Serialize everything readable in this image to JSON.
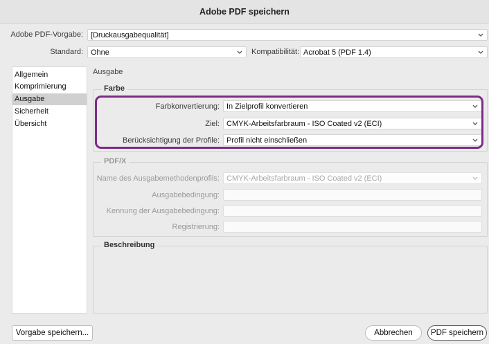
{
  "window": {
    "title": "Adobe PDF speichern"
  },
  "preset": {
    "label": "Adobe PDF-Vorgabe:",
    "value": "[Druckausgabequalität]"
  },
  "standard": {
    "label": "Standard:",
    "value": "Ohne"
  },
  "compat": {
    "label": "Kompatibilität:",
    "value": "Acrobat 5 (PDF 1.4)"
  },
  "sidebar": {
    "items": [
      {
        "label": "Allgemein"
      },
      {
        "label": "Komprimierung"
      },
      {
        "label": "Ausgabe"
      },
      {
        "label": "Sicherheit"
      },
      {
        "label": "Übersicht"
      }
    ]
  },
  "section": {
    "title": "Ausgabe"
  },
  "farbe": {
    "title": "Farbe",
    "conversion": {
      "label": "Farbkonvertierung:",
      "value": "In Zielprofil konvertieren"
    },
    "target": {
      "label": "Ziel:",
      "value": "CMYK-Arbeitsfarbraum - ISO Coated v2 (ECI)"
    },
    "profiles": {
      "label": "Berücksichtigung der Profile:",
      "value": "Profil nicht einschließen"
    }
  },
  "pdfx": {
    "title": "PDF/X",
    "output_profile": {
      "label": "Name des Ausgabemethodenprofils:",
      "value": "CMYK-Arbeitsfarbraum - ISO Coated v2 (ECI)"
    },
    "condition": {
      "label": "Ausgabebedingung:"
    },
    "condition_id": {
      "label": "Kennung der Ausgabebedingung:"
    },
    "registry": {
      "label": "Registrierung:"
    }
  },
  "description": {
    "title": "Beschreibung"
  },
  "buttons": {
    "save_preset": "Vorgabe speichern...",
    "cancel": "Abbrechen",
    "save_pdf": "PDF speichern"
  },
  "colors": {
    "highlight": "#7b2c86",
    "active_nav": "#d0d0d0"
  }
}
